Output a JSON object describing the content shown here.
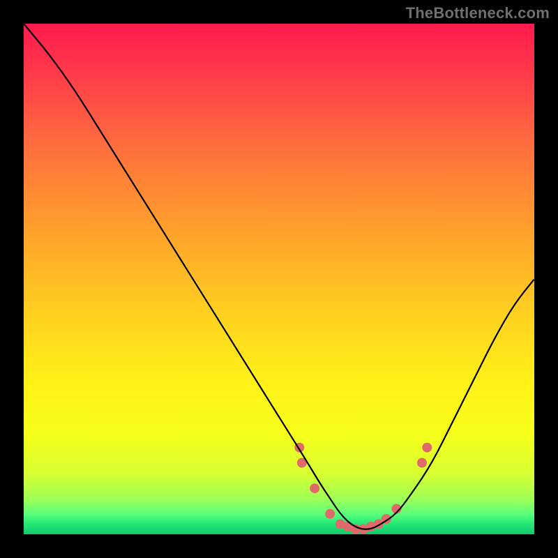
{
  "watermark": "TheBottleneck.com",
  "chart_data": {
    "type": "line",
    "title": "",
    "xlabel": "",
    "ylabel": "",
    "xlim": [
      0,
      100
    ],
    "ylim": [
      0,
      100
    ],
    "grid": false,
    "legend": false,
    "series": [
      {
        "name": "bottleneck-curve",
        "color": "#000000",
        "x": [
          0,
          5,
          10,
          15,
          20,
          25,
          30,
          35,
          40,
          45,
          50,
          55,
          58,
          60,
          62,
          64,
          66,
          68,
          70,
          73,
          76,
          80,
          84,
          88,
          92,
          96,
          100
        ],
        "y": [
          100,
          94,
          87,
          79,
          71,
          63,
          55,
          47,
          39,
          31,
          23,
          15,
          10,
          7,
          4,
          2,
          1,
          1,
          2,
          4,
          8,
          14,
          22,
          30,
          38,
          45,
          50
        ]
      }
    ],
    "markers": {
      "name": "highlight-dots",
      "color": "#e06a6a",
      "radius": 7,
      "x": [
        54,
        54.5,
        57,
        60,
        62,
        63.5,
        65,
        66.5,
        68,
        69.5,
        71,
        73,
        78,
        79
      ],
      "y": [
        17,
        14,
        9,
        4,
        2,
        1.5,
        1,
        1,
        1.5,
        2,
        3,
        5,
        14,
        17
      ]
    }
  }
}
